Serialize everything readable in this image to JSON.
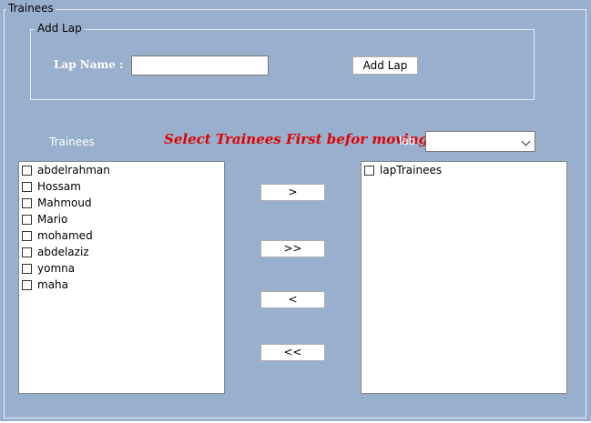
{
  "group_title": "Trainees",
  "add_lap": {
    "legend": "Add Lap",
    "lap_name_label": "Lap Name :",
    "lap_name_value": "",
    "add_button": "Add Lap"
  },
  "trainees_label": "Trainees",
  "warning": "Select Trainees First befor moving",
  "lab": {
    "label": "lab",
    "selected": ""
  },
  "left_list": [
    {
      "label": "abdelrahman",
      "checked": false
    },
    {
      "label": "Hossam",
      "checked": false
    },
    {
      "label": "Mahmoud",
      "checked": false
    },
    {
      "label": "Mario",
      "checked": false
    },
    {
      "label": "mohamed",
      "checked": false
    },
    {
      "label": "abdelaziz",
      "checked": false
    },
    {
      "label": "yomna",
      "checked": false
    },
    {
      "label": "maha",
      "checked": false
    }
  ],
  "right_list": [
    {
      "label": "lapTrainees",
      "checked": false
    }
  ],
  "move_buttons": {
    "move_right": ">",
    "move_all_right": ">>",
    "move_left": "<",
    "move_all_left": "<<"
  },
  "colors": {
    "background": "#98b0cd",
    "warning_text": "#e00000",
    "label_text": "#ffffff"
  }
}
